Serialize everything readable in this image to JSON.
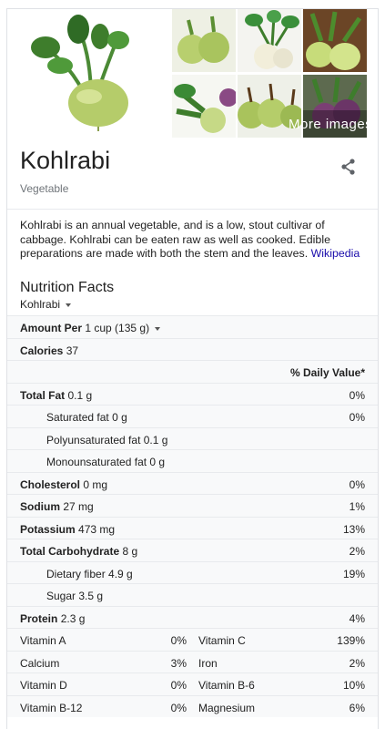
{
  "images": {
    "more_images": "More images"
  },
  "title": "Kohlrabi",
  "subtitle": "Vegetable",
  "description": {
    "text": "Kohlrabi is an annual vegetable, and is a low, stout cultivar of cabbage. Kohlrabi can be eaten raw as well as cooked. Edible preparations are made with both the stem and the leaves.",
    "source_link": "Wikipedia"
  },
  "nutrition": {
    "title": "Nutrition Facts",
    "selector": "Kohlrabi",
    "amount_label": "Amount Per",
    "amount_value": "1 cup (135 g)",
    "calories_label": "Calories",
    "calories_value": "37",
    "daily_value_header": "% Daily Value*",
    "rows": [
      {
        "label": "Total Fat",
        "value": "0.1 g",
        "dv": "0%",
        "bold": true
      },
      {
        "label": "Saturated fat",
        "value": "0 g",
        "dv": "0%",
        "bold": false
      },
      {
        "label": "Polyunsaturated fat",
        "value": "0.1 g",
        "dv": "",
        "bold": false
      },
      {
        "label": "Monounsaturated fat",
        "value": "0 g",
        "dv": "",
        "bold": false
      },
      {
        "label": "Cholesterol",
        "value": "0 mg",
        "dv": "0%",
        "bold": true
      },
      {
        "label": "Sodium",
        "value": "27 mg",
        "dv": "1%",
        "bold": true
      },
      {
        "label": "Potassium",
        "value": "473 mg",
        "dv": "13%",
        "bold": true
      },
      {
        "label": "Total Carbohydrate",
        "value": "8 g",
        "dv": "2%",
        "bold": true
      },
      {
        "label": "Dietary fiber",
        "value": "4.9 g",
        "dv": "19%",
        "bold": false
      },
      {
        "label": "Sugar",
        "value": "3.5 g",
        "dv": "",
        "bold": false
      },
      {
        "label": "Protein",
        "value": "2.3 g",
        "dv": "4%",
        "bold": true
      }
    ],
    "vitamins": [
      {
        "n1": "Vitamin A",
        "v1": "0%",
        "n2": "Vitamin C",
        "v2": "139%"
      },
      {
        "n1": "Calcium",
        "v1": "3%",
        "n2": "Iron",
        "v2": "2%"
      },
      {
        "n1": "Vitamin D",
        "v1": "0%",
        "n2": "Vitamin B-6",
        "v2": "10%"
      },
      {
        "n1": "Vitamin B-12",
        "v1": "0%",
        "n2": "Magnesium",
        "v2": "6%"
      }
    ]
  },
  "colors": {
    "link": "#1a0dab",
    "kohlrabi_green": "#b5cc6a",
    "kohlrabi_purple": "#7b3f74",
    "leaf_green": "#3e7d2c"
  }
}
